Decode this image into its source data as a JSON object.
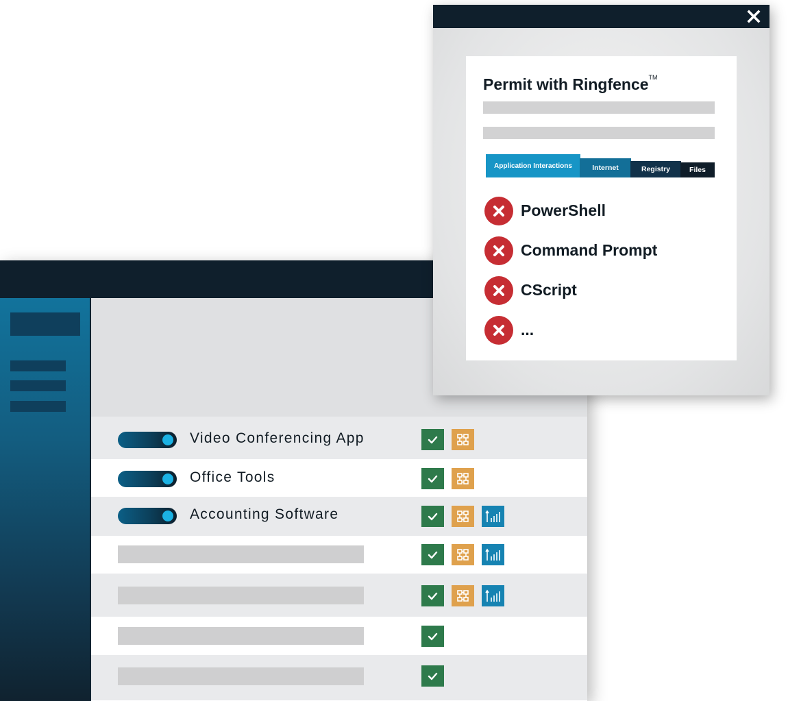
{
  "colors": {
    "titlebar": "#0f1f2c",
    "accent_blue": "#1795c6",
    "check_green": "#2e7a4b",
    "network_orange": "#dfa14d",
    "registry_blue": "#1683b2",
    "deny_red": "#c62d33"
  },
  "popup": {
    "close_icon": "close-icon",
    "title": "Permit with Ringfence",
    "title_mark": "TM",
    "tabs": [
      {
        "label": "Application Interactions",
        "active": true
      },
      {
        "label": "Internet",
        "active": false
      },
      {
        "label": "Registry",
        "active": false
      },
      {
        "label": "Files",
        "active": false
      }
    ],
    "blocked": [
      {
        "label": "PowerShell",
        "icon": "deny-x-icon"
      },
      {
        "label": "Command Prompt",
        "icon": "deny-x-icon"
      },
      {
        "label": "CScript",
        "icon": "deny-x-icon"
      },
      {
        "label": "...",
        "icon": "deny-x-icon"
      }
    ]
  },
  "apps": [
    {
      "name": "Video Conferencing App",
      "enabled": true,
      "icons": [
        "check-icon",
        "network-icon"
      ]
    },
    {
      "name": "Office Tools",
      "enabled": true,
      "icons": [
        "check-icon",
        "network-icon"
      ]
    },
    {
      "name": "Accounting Software",
      "enabled": true,
      "icons": [
        "check-icon",
        "network-icon",
        "registry-icon"
      ]
    },
    {
      "name": "",
      "enabled": null,
      "icons": [
        "check-icon",
        "network-icon",
        "registry-icon"
      ]
    },
    {
      "name": "",
      "enabled": null,
      "icons": [
        "check-icon",
        "network-icon",
        "registry-icon"
      ]
    },
    {
      "name": "",
      "enabled": null,
      "icons": [
        "check-icon"
      ]
    },
    {
      "name": "",
      "enabled": null,
      "icons": [
        "check-icon"
      ]
    }
  ]
}
